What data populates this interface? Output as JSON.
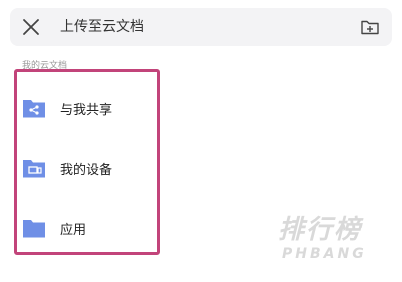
{
  "header": {
    "title": "上传至云文档",
    "close_icon": "close-icon",
    "add_icon": "add-folder-icon"
  },
  "section": {
    "label": "我的云文档"
  },
  "items": [
    {
      "label": "与我共享",
      "icon": "shared-folder-icon"
    },
    {
      "label": "我的设备",
      "icon": "device-folder-icon"
    },
    {
      "label": "应用",
      "icon": "folder-icon"
    }
  ],
  "watermark": {
    "cn": "排行榜",
    "en": "PHBANG"
  },
  "colors": {
    "folder": "#6f8fe6",
    "highlight": "#c2447a",
    "header_bg": "#f3f3f5"
  }
}
